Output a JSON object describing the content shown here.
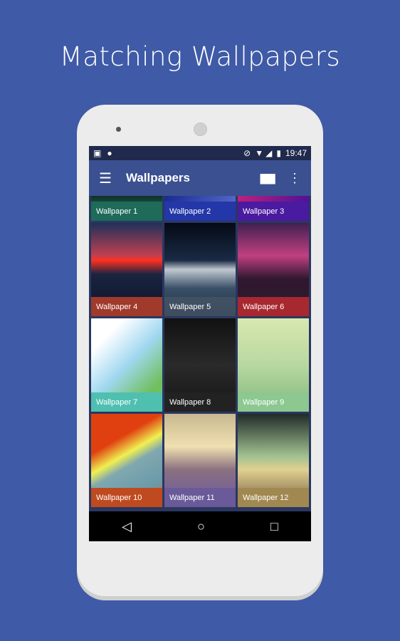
{
  "headline": "Matching Wallpapers",
  "status": {
    "time": "19:47"
  },
  "appbar": {
    "title": "Wallpapers",
    "menu_icon": "hamburger-icon",
    "view_icon": "columns-icon",
    "more_icon": "more-vert-icon"
  },
  "wallpapers": [
    {
      "label": "Wallpaper 1",
      "color": "#1e6b5a"
    },
    {
      "label": "Wallpaper 2",
      "color": "#2337a8"
    },
    {
      "label": "Wallpaper 3",
      "color": "#4a1aa0"
    },
    {
      "label": "Wallpaper 4",
      "color": "#a03a2a"
    },
    {
      "label": "Wallpaper 5",
      "color": "#465466"
    },
    {
      "label": "Wallpaper 6",
      "color": "#a82830"
    },
    {
      "label": "Wallpaper 7",
      "color": "#4fc0b0"
    },
    {
      "label": "Wallpaper 8",
      "color": "#222222"
    },
    {
      "label": "Wallpaper 9",
      "color": "#8cc890"
    },
    {
      "label": "Wallpaper 10",
      "color": "#c04a20"
    },
    {
      "label": "Wallpaper 11",
      "color": "#6a5a9a"
    },
    {
      "label": "Wallpaper 12",
      "color": "#a08850"
    }
  ]
}
